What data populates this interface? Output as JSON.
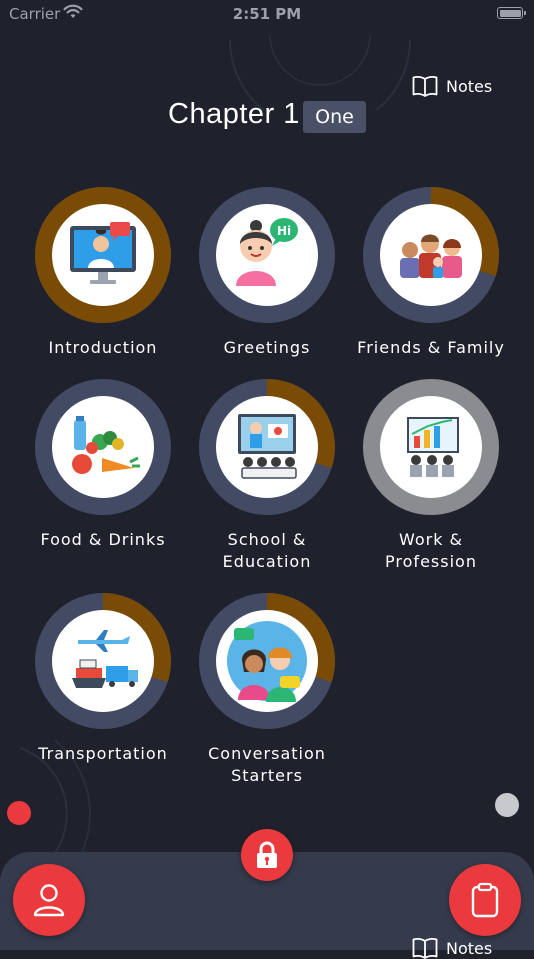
{
  "status_bar": {
    "carrier": "Carrier",
    "time": "2:51 PM"
  },
  "header": {
    "notes_label": "Notes",
    "chapter_title": "Chapter 1",
    "chapter_badge": "One"
  },
  "topics": [
    {
      "label": "Introduction",
      "progress": 1.0,
      "icon": "video-call-icon"
    },
    {
      "label": "Greetings",
      "progress": 0.0,
      "icon": "greeting-person-icon"
    },
    {
      "label": "Friends & Family",
      "progress": 0.3,
      "icon": "family-group-icon"
    },
    {
      "label": "Food & Drinks",
      "progress": 0.0,
      "icon": "food-drinks-icon"
    },
    {
      "label": "School & Education",
      "progress": 0.3,
      "icon": "classroom-icon"
    },
    {
      "label": "Work & Profession",
      "progress": 0.0,
      "locked_gray": true,
      "icon": "presentation-icon"
    },
    {
      "label": "Transportation",
      "progress": 0.3,
      "icon": "transport-icon"
    },
    {
      "label": "Conversation Starters",
      "progress": 0.3,
      "icon": "conversation-icon"
    }
  ],
  "bottom_bar": {
    "notes_label": "Notes"
  },
  "colors": {
    "background": "#1f222d",
    "ring_track": "#434a63",
    "ring_progress": "#7a4b05",
    "ring_gray": "#8b8c90",
    "accent_red": "#ea3a3d",
    "bar": "#353a4c"
  }
}
